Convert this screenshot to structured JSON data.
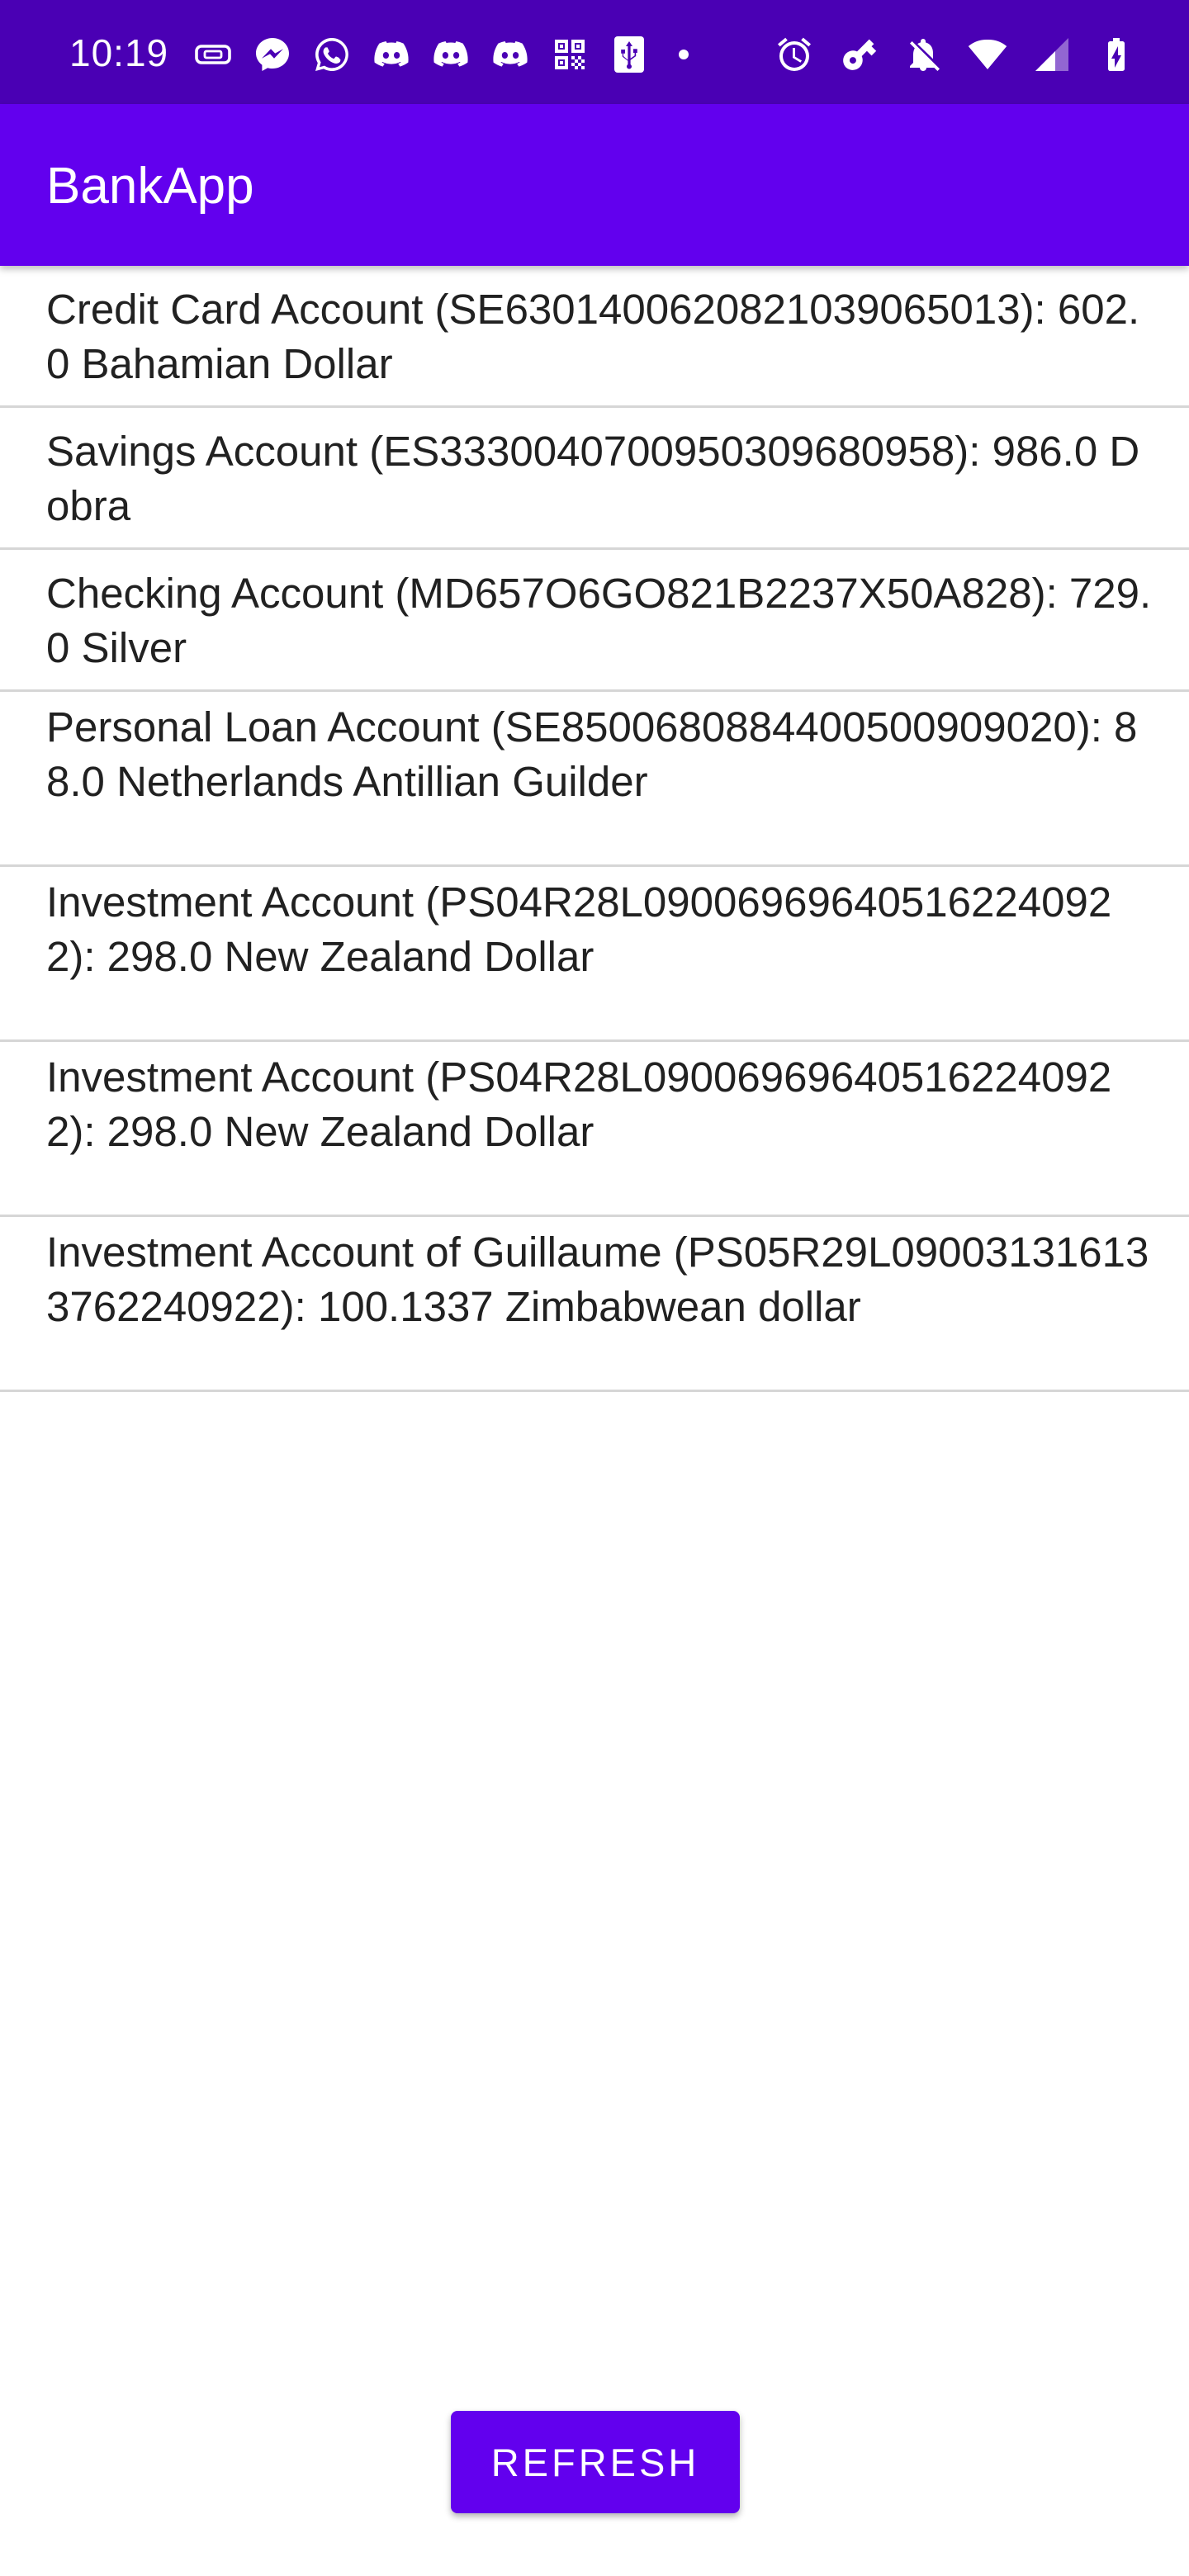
{
  "status_bar": {
    "time": "10:19",
    "left_icons": [
      "sim-card-icon",
      "messenger-icon",
      "whatsapp-icon",
      "discord-icon",
      "discord-icon",
      "discord-icon",
      "qr-code-icon",
      "usb-icon"
    ],
    "right_icons": [
      "alarm-icon",
      "key-icon",
      "notifications-off-icon",
      "wifi-icon",
      "cellular-signal-icon",
      "battery-charging-icon"
    ]
  },
  "app_bar": {
    "title": "BankApp"
  },
  "accounts": [
    {
      "label": "Credit Card Account (SE6301400620821039065013): 602.0 Bahamian Dollar"
    },
    {
      "label": "Savings Account (ES3330040700950309680958): 986.0 Dobra"
    },
    {
      "label": "Checking Account (MD657O6GO821B2237X50A828): 729.0 Silver"
    },
    {
      "label": "Personal Loan Account (SE8500680884400500909020): 88.0 Netherlands Antillian Guilder"
    },
    {
      "label": "Investment Account (PS04R28L090069696405162240922): 298.0 New Zealand Dollar"
    },
    {
      "label": "Investment Account (PS04R28L090069696405162240922): 298.0 New Zealand Dollar"
    },
    {
      "label": "Investment Account of Guillaume (PS05R29L090031316133762240922): 100.1337 Zimbabwean dollar"
    }
  ],
  "refresh_button": {
    "label": "REFRESH"
  },
  "colors": {
    "status_bar": "#4a00b4",
    "app_bar": "#6200ee",
    "button": "#6200ee",
    "divider": "#d6d6d6"
  }
}
